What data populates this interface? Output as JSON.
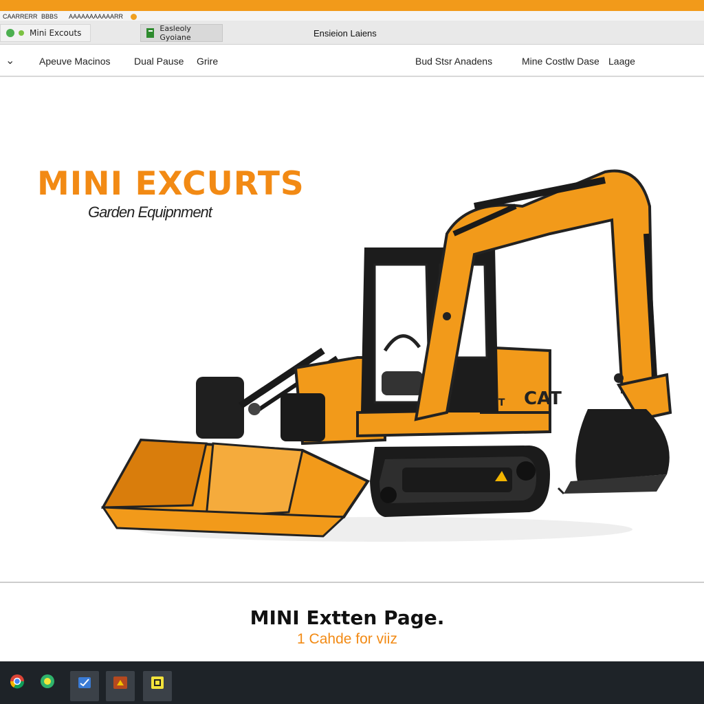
{
  "window": {
    "title_strip": [
      "CAARRERR",
      "BBBS",
      "AAAAAAAAAAARR"
    ],
    "title": "Ensieion Laiens",
    "accent_color": "#f29a1a"
  },
  "tabs": [
    {
      "label": "Mini Excouts",
      "icon": "globe-icon"
    },
    {
      "label": "Easleoly Gyoiane",
      "icon": "document-icon"
    }
  ],
  "nav": {
    "items": [
      "Apeuve Macinos",
      "Dual Pause",
      "Grire"
    ],
    "right_items": [
      "Bud Stsr Anadens",
      "Mine Costlw Dase",
      "Laage"
    ]
  },
  "hero": {
    "brand": "MINI EXCURTS",
    "subtitle": "Garden Equipnment",
    "cab_logo": "CAT",
    "side_badge": "OT",
    "image": "mini-excavator-illustration"
  },
  "footer": {
    "title": "MINI Extten Page.",
    "subtitle": "1 Cahde for viiz"
  },
  "taskbar": {
    "icons": [
      "chrome-icon",
      "edge-icon",
      "mail-icon",
      "folder-icon",
      "notes-icon"
    ]
  }
}
